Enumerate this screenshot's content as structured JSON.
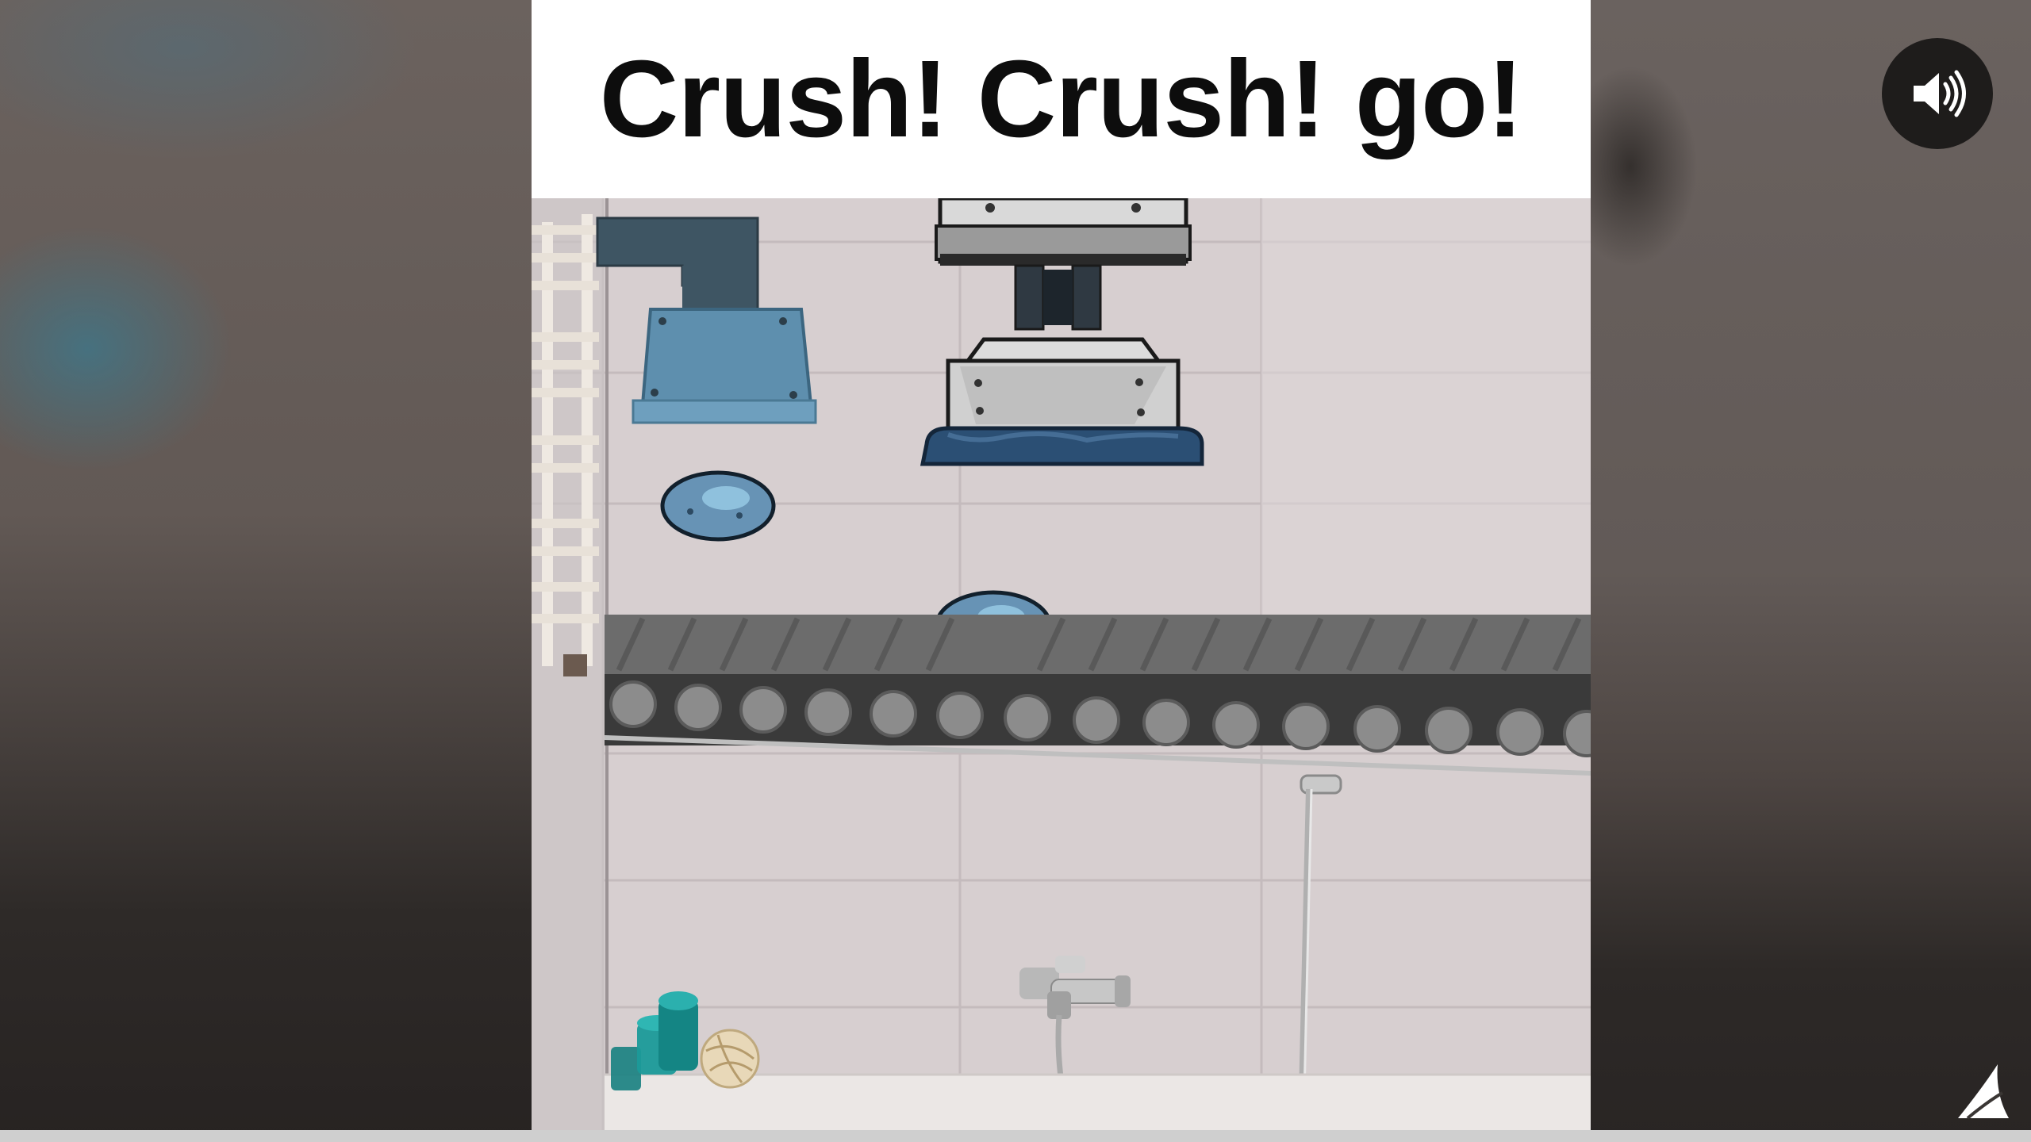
{
  "video": {
    "caption": "Crush! Crush! go!"
  },
  "controls": {
    "speaker_icon": "speaker-volume-icon",
    "logo_icon": "brand-sail-logo"
  },
  "scene": {
    "objects": [
      "pipe-dispenser",
      "hydraulic-press",
      "blue-blob",
      "conveyor-belt",
      "bathtub-faucet",
      "shower-head",
      "candles",
      "rattan-ball",
      "towel-rail"
    ]
  },
  "colors": {
    "caption_background": "#ffffff",
    "caption_text": "#0d0d0d",
    "button_background": "#1e1c1b"
  }
}
